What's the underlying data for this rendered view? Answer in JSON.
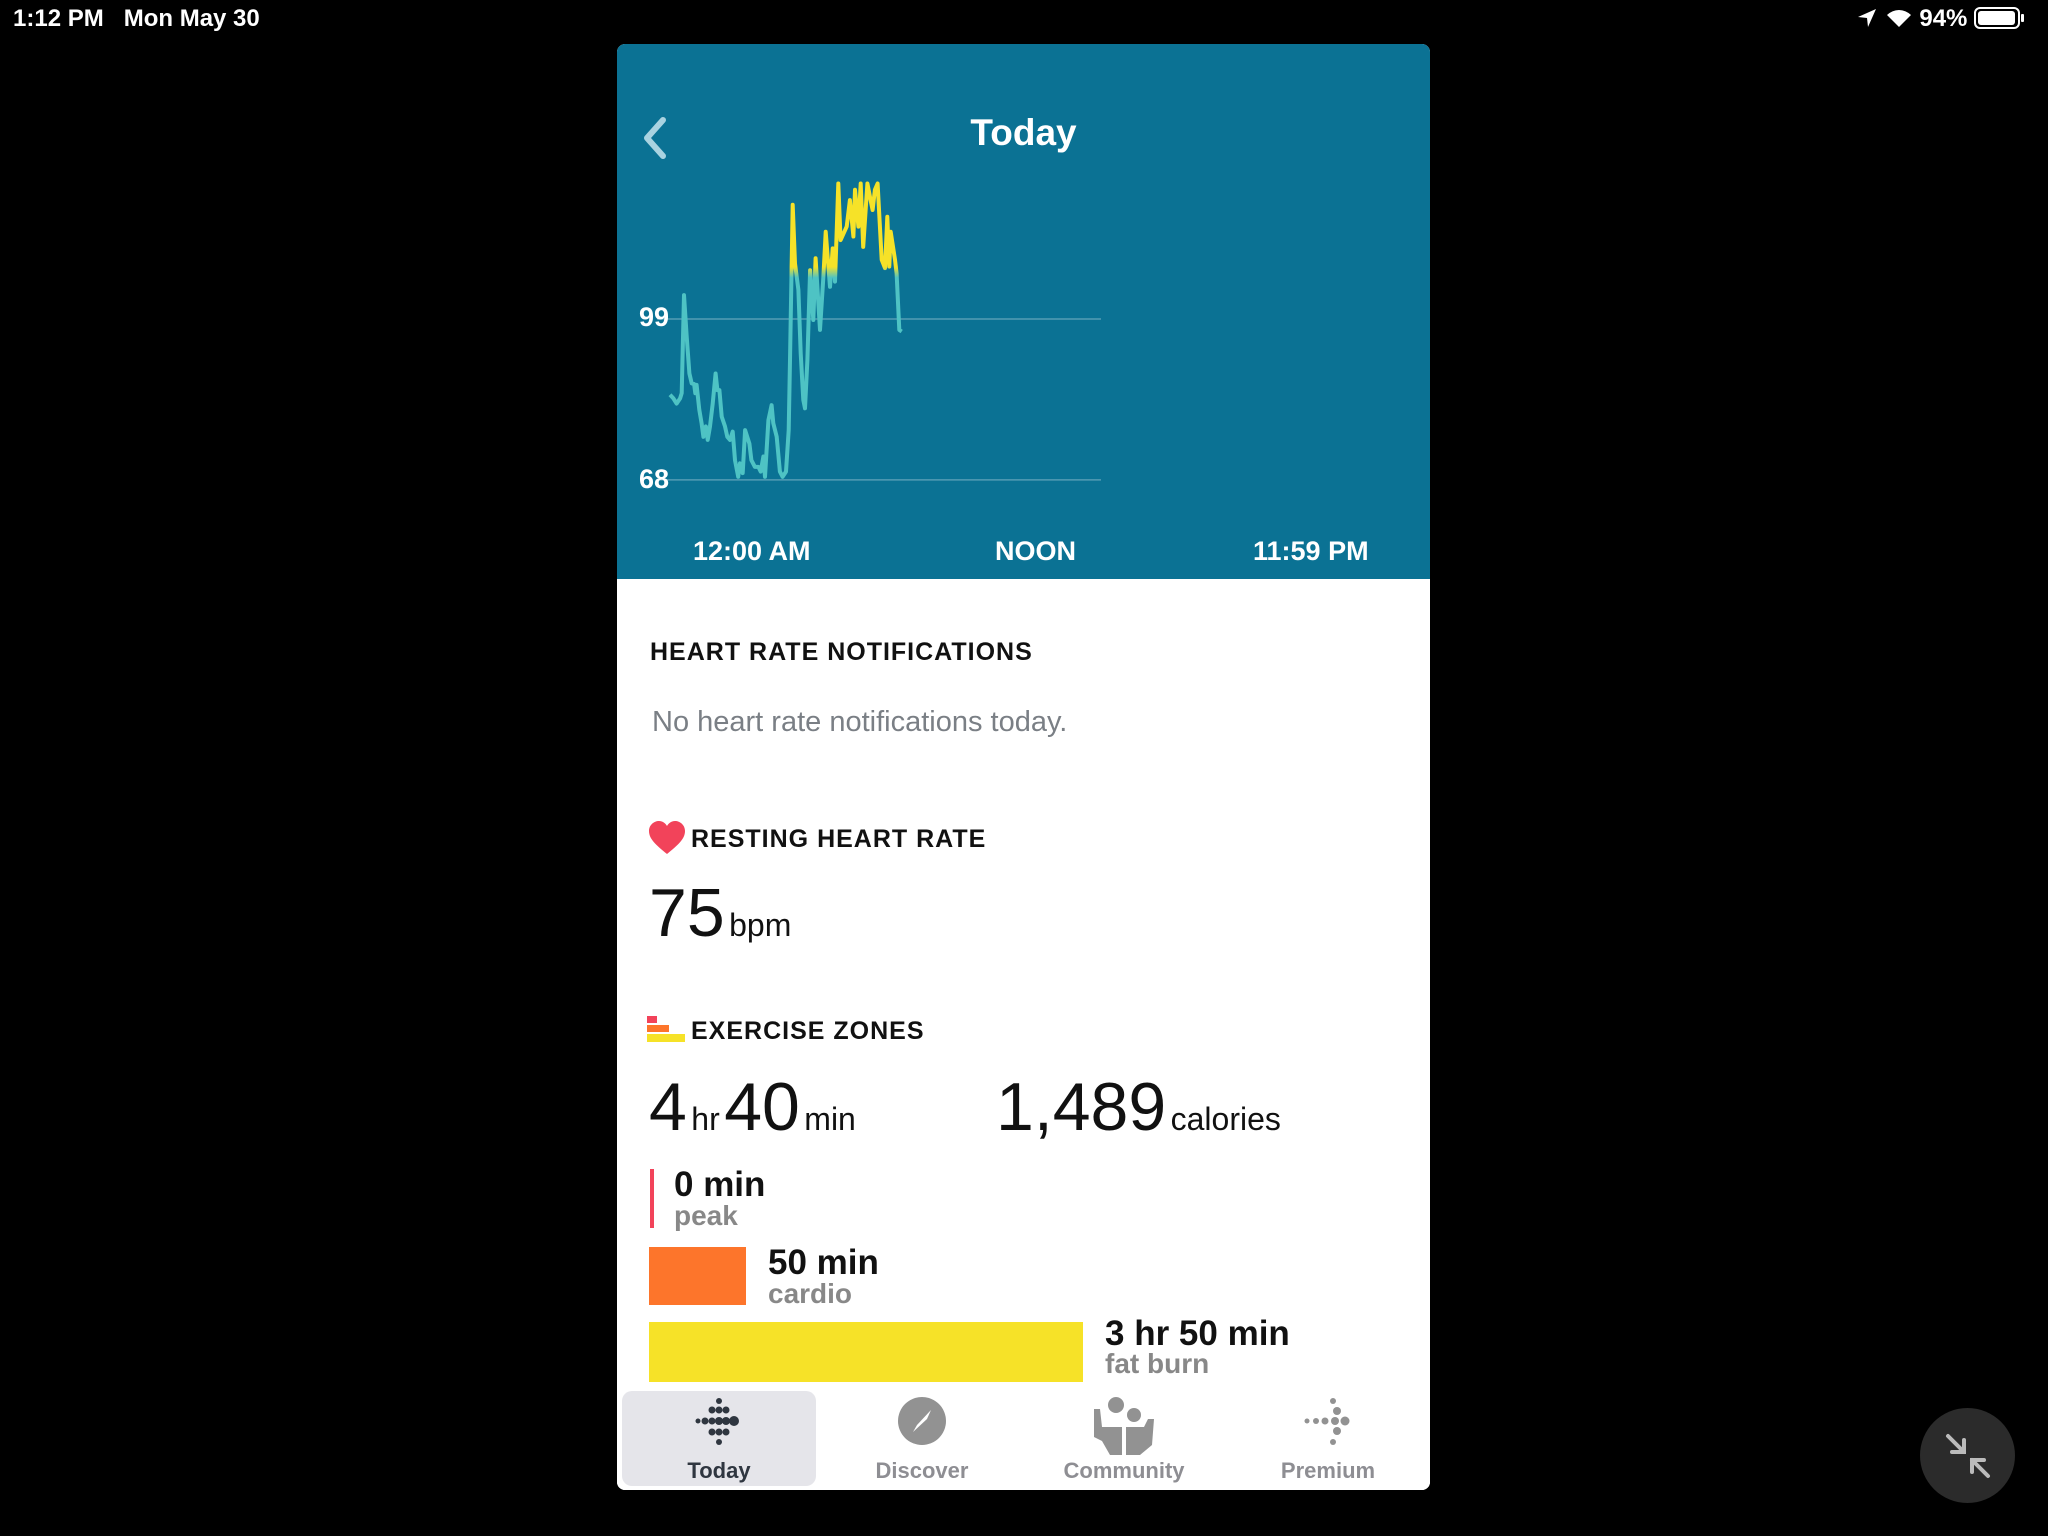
{
  "status_bar": {
    "time": "1:12 PM",
    "date": "Mon May 30",
    "battery": "94%"
  },
  "header": {
    "title": "Today",
    "back_icon": "chevron-left-icon"
  },
  "chart_data": {
    "type": "line",
    "title": "",
    "yticks": [
      "99",
      "68"
    ],
    "ytick_values": [
      99,
      68
    ],
    "xticks": [
      "12:00 AM",
      "NOON",
      "11:59 PM"
    ],
    "xlim_hours": [
      0,
      24
    ],
    "zone_threshold_bpm": 108,
    "colors": {
      "normal": "#4ec3c4",
      "fat_burn_zone": "#f6e228",
      "background": "#0b7294"
    },
    "points": [
      [
        0,
        84.4
      ],
      [
        0.19,
        83.7
      ],
      [
        0.37,
        82.7
      ],
      [
        0.56,
        83.7
      ],
      [
        0.65,
        84.7
      ],
      [
        0.78,
        103.6
      ],
      [
        0.93,
        95.6
      ],
      [
        1.08,
        88.5
      ],
      [
        1.21,
        86.6
      ],
      [
        1.34,
        86.5
      ],
      [
        1.41,
        84.7
      ],
      [
        1.48,
        86.3
      ],
      [
        1.63,
        81.5
      ],
      [
        1.76,
        78.9
      ],
      [
        1.86,
        76.3
      ],
      [
        2.0,
        78.3
      ],
      [
        2.1,
        75.7
      ],
      [
        2.23,
        78.3
      ],
      [
        2.38,
        82.7
      ],
      [
        2.54,
        88.5
      ],
      [
        2.64,
        85.3
      ],
      [
        2.75,
        85.3
      ],
      [
        2.88,
        80.2
      ],
      [
        3.06,
        78.3
      ],
      [
        3.19,
        76.3
      ],
      [
        3.34,
        75.7
      ],
      [
        3.49,
        77.3
      ],
      [
        3.62,
        71.8
      ],
      [
        3.8,
        68.6
      ],
      [
        3.9,
        71.2
      ],
      [
        4.05,
        69.3
      ],
      [
        4.18,
        77.6
      ],
      [
        4.42,
        75.0
      ],
      [
        4.53,
        71.8
      ],
      [
        4.73,
        70.5
      ],
      [
        4.92,
        70.5
      ],
      [
        5.05,
        69.6
      ],
      [
        5.2,
        72.5
      ],
      [
        5.29,
        68.6
      ],
      [
        5.48,
        79.5
      ],
      [
        5.66,
        82.4
      ],
      [
        5.75,
        78.9
      ],
      [
        5.94,
        76.3
      ],
      [
        6.12,
        69.6
      ],
      [
        6.27,
        68.6
      ],
      [
        6.46,
        69.6
      ],
      [
        6.61,
        77.6
      ],
      [
        6.68,
        91.1
      ],
      [
        6.83,
        121.0
      ],
      [
        6.96,
        109.7
      ],
      [
        7.15,
        104.6
      ],
      [
        7.28,
        92.4
      ],
      [
        7.42,
        83.4
      ],
      [
        7.52,
        81.8
      ],
      [
        7.65,
        91.1
      ],
      [
        7.8,
        108.4
      ],
      [
        7.98,
        98.8
      ],
      [
        8.11,
        110.7
      ],
      [
        8.35,
        96.9
      ],
      [
        8.54,
        107.2
      ],
      [
        8.67,
        115.8
      ],
      [
        8.91,
        105.2
      ],
      [
        9.06,
        112.6
      ],
      [
        9.19,
        106.2
      ],
      [
        9.37,
        125.1
      ],
      [
        9.5,
        114.2
      ],
      [
        9.84,
        116.8
      ],
      [
        10.02,
        121.9
      ],
      [
        10.21,
        114.9
      ],
      [
        10.3,
        123.9
      ],
      [
        10.49,
        116.8
      ],
      [
        10.62,
        125.1
      ],
      [
        10.76,
        112.9
      ],
      [
        10.99,
        125.1
      ],
      [
        11.17,
        121.9
      ],
      [
        11.28,
        120.0
      ],
      [
        11.41,
        123.9
      ],
      [
        11.56,
        125.1
      ],
      [
        11.79,
        110.4
      ],
      [
        11.97,
        108.8
      ],
      [
        12.1,
        118.7
      ],
      [
        12.21,
        109.1
      ],
      [
        12.29,
        115.8
      ],
      [
        12.53,
        110.4
      ],
      [
        12.62,
        107.8
      ],
      [
        12.77,
        96.9
      ],
      [
        12.9,
        96.6
      ]
    ]
  },
  "notifications": {
    "heading": "HEART RATE NOTIFICATIONS",
    "message": "No heart rate notifications today."
  },
  "resting": {
    "heading": "RESTING HEART RATE",
    "value": "75",
    "unit": "bpm"
  },
  "zones": {
    "heading": "EXERCISE ZONES",
    "hours": "4",
    "hours_unit": "hr",
    "minutes": "40",
    "minutes_unit": "min",
    "calories": "1,489",
    "calories_unit": "calories",
    "items": [
      {
        "value": "0 min",
        "label": "peak",
        "minutes": 0,
        "color": "#f2435a"
      },
      {
        "value": "50 min",
        "label": "cardio",
        "minutes": 50,
        "color": "#fd752b"
      },
      {
        "value": "3 hr 50 min",
        "label": "fat burn",
        "minutes": 230,
        "color": "#f6e228"
      }
    ]
  },
  "tabs": [
    {
      "label": "Today",
      "active": true
    },
    {
      "label": "Discover"
    },
    {
      "label": "Community"
    },
    {
      "label": "Premium"
    }
  ]
}
